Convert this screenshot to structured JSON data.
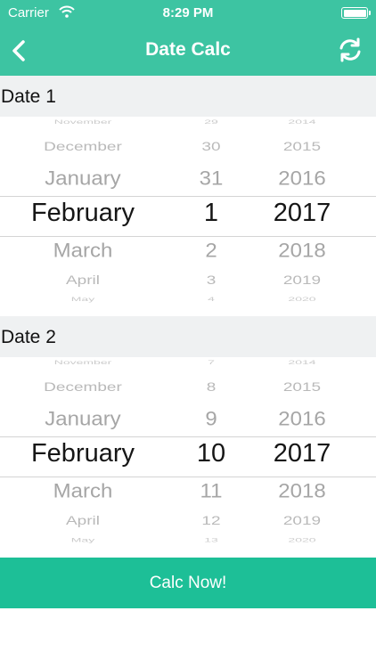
{
  "status_bar": {
    "carrier": "Carrier",
    "time": "8:29 PM"
  },
  "nav": {
    "title": "Date Calc",
    "back_icon": "chevron-left-icon",
    "refresh_icon": "refresh-icon"
  },
  "date1": {
    "label": "Date 1",
    "months": [
      "November",
      "December",
      "January",
      "February",
      "March",
      "April",
      "May"
    ],
    "days": [
      "29",
      "30",
      "31",
      "1",
      "2",
      "3",
      "4"
    ],
    "years": [
      "2014",
      "2015",
      "2016",
      "2017",
      "2018",
      "2019",
      "2020"
    ],
    "selected": {
      "month": "February",
      "day": "1",
      "year": "2017"
    }
  },
  "date2": {
    "label": "Date 2",
    "months": [
      "November",
      "December",
      "January",
      "February",
      "March",
      "April",
      "May"
    ],
    "days": [
      "7",
      "8",
      "9",
      "10",
      "11",
      "12",
      "13"
    ],
    "years": [
      "2014",
      "2015",
      "2016",
      "2017",
      "2018",
      "2019",
      "2020"
    ],
    "selected": {
      "month": "February",
      "day": "10",
      "year": "2017"
    }
  },
  "calc_button": {
    "label": "Calc Now!"
  },
  "colors": {
    "primary": "#3dc4a2",
    "button": "#1dbf97",
    "section_bg": "#eff1f2"
  }
}
